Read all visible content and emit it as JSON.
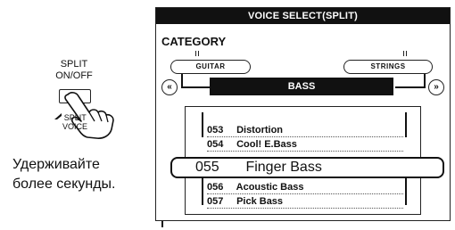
{
  "left": {
    "button_label_line1": "SPLIT",
    "button_label_line2": "ON/OFF",
    "split_voice_line1": "SPLIT",
    "split_voice_line2": "VOICE",
    "instruction_line1": "Удерживайте",
    "instruction_line2": "более секунды."
  },
  "panel": {
    "title": "VOICE SELECT(SPLIT)",
    "category_label": "CATEGORY",
    "category_left": "GUITAR",
    "category_right": "STRINGS",
    "current_category": "BASS",
    "prev_icon": "rewind-icon",
    "next_icon": "fast-forward-icon",
    "voices_above": [
      {
        "number": "053",
        "name": "Distortion"
      },
      {
        "number": "054",
        "name": "Cool! E.Bass"
      }
    ],
    "selected_voice": {
      "number": "055",
      "name": "Finger Bass"
    },
    "voices_below": [
      {
        "number": "056",
        "name": "Acoustic Bass"
      },
      {
        "number": "057",
        "name": "Pick Bass"
      }
    ]
  }
}
